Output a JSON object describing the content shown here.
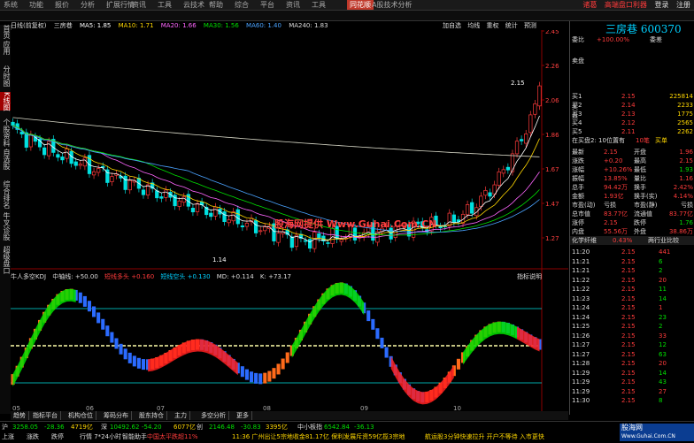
{
  "menu": [
    "系统",
    "功能",
    "报价",
    "分析",
    "扩展行情",
    "资讯",
    "工具",
    "云技术",
    "帮助",
    "综合",
    "平台",
    "资讯",
    "工具"
  ],
  "brand": "同花顺",
  "app_title": "A股技术分析",
  "right_links": [
    "诸葛",
    "高端盘口利器",
    "登录",
    "注册"
  ],
  "left_tabs": [
    "首页",
    "应用",
    "分时图",
    "K线图",
    "个股资料",
    "自选股",
    "综合排名",
    "牛叉诊股",
    "超级盘口"
  ],
  "chart_header": {
    "period": "日线(前复权)",
    "stock": "三房巷",
    "ma5": "MA5: 1.85",
    "ma10": "MA10: 1.71",
    "ma20": "MA20: 1.66",
    "ma30": "MA30: 1.56",
    "ma60": "MA60: 1.40",
    "ma240": "MA240: 1.83"
  },
  "tools": [
    "加自选",
    "均线",
    "重权",
    "统计",
    "预测"
  ],
  "price_axis": [
    "2.45",
    "2.26",
    "2.06",
    "1.86",
    "1.67",
    "1.47",
    "1.27"
  ],
  "price_labels": {
    "high": "2.15",
    "low": "1.14"
  },
  "watermark": "股海网提供 Www.Guhai.Com.CN",
  "lower_header": {
    "name": "牛人多空KDJ",
    "mid": "中轴线: +50.00",
    "s1": "短线多头 +0.160",
    "s2": "短线空头 +0.130",
    "md": "MD: +0.114",
    "k": "K: +73.17",
    "help": "指标说明"
  },
  "month_axis": [
    "05",
    "06",
    "07",
    "08",
    "09",
    "10"
  ],
  "bottom_tabs": [
    "趋势",
    "指标平台",
    "机构仓位",
    "筹码分布",
    "股东持仓",
    "主力",
    "多空分析",
    "更多"
  ],
  "quote": {
    "name": "三房巷 600370",
    "weibi": "委比",
    "weibi_val": "+100.00%",
    "wei_ratio": "委差",
    "sell_label": "卖盘",
    "buy_label": "买盘",
    "buy_rows": [
      [
        "买1",
        "2.15",
        "225814"
      ],
      [
        "买2",
        "2.14",
        "2233"
      ],
      [
        "买3",
        "2.13",
        "1775"
      ],
      [
        "买4",
        "2.12",
        "2565"
      ],
      [
        "买5",
        "2.11",
        "2262"
      ]
    ],
    "bid_info": "在买盘2: 10位置有",
    "bid_info2": "10笔",
    "bid_info3": "买单",
    "stats": [
      [
        "最新",
        "2.15",
        "开盘",
        "1.96"
      ],
      [
        "涨跌",
        "+0.20",
        "最高",
        "2.15"
      ],
      [
        "涨幅",
        "+10.26%",
        "最低",
        "1.93"
      ],
      [
        "振幅",
        "13.85%",
        "量比",
        "1.16"
      ],
      [
        "总手",
        "94.42万",
        "换手",
        "2.42%"
      ],
      [
        "金额",
        "1.93亿",
        "换手(实)",
        "4.14%"
      ],
      [
        "市盈(动)",
        "亏损",
        "市盈(静)",
        "亏损"
      ],
      [
        "总市值",
        "83.77亿",
        "流通值",
        "83.77亿"
      ],
      [
        "涨停",
        "2.15",
        "跌停",
        "1.76"
      ],
      [
        "内盘",
        "55.56万",
        "外盘",
        "38.86万"
      ]
    ],
    "industry": "化学纤维",
    "industry_pct": "0.43%",
    "industry_tab": "两行业比较",
    "ticks": [
      [
        "11:20",
        "2.15",
        "441"
      ],
      [
        "11:21",
        "2.15",
        "6"
      ],
      [
        "11:21",
        "2.15",
        "2"
      ],
      [
        "11:22",
        "2.15",
        "20"
      ],
      [
        "11:22",
        "2.15",
        "11"
      ],
      [
        "11:23",
        "2.15",
        "14"
      ],
      [
        "11:24",
        "2.15",
        "1"
      ],
      [
        "11:24",
        "2.15",
        "23"
      ],
      [
        "11:25",
        "2.15",
        "2"
      ],
      [
        "11:26",
        "2.15",
        "33"
      ],
      [
        "11:27",
        "2.15",
        "12"
      ],
      [
        "11:27",
        "2.15",
        "63"
      ],
      [
        "11:28",
        "2.15",
        "20"
      ],
      [
        "11:29",
        "2.15",
        "14"
      ],
      [
        "11:29",
        "2.15",
        "43"
      ],
      [
        "11:29",
        "2.15",
        "27"
      ],
      [
        "11:30",
        "2.15",
        "8"
      ]
    ]
  },
  "status": {
    "row1": [
      "沪",
      "3258.05",
      "-28.36",
      "4719亿",
      "深",
      "10492.62",
      "-54.20",
      "6077亿",
      "创",
      "2146.48",
      "-30.83",
      "3395亿",
      "中小板指",
      "6542.84",
      "-36.13"
    ],
    "row2": [
      "上涨",
      "涨跌",
      "跌停",
      "行情 7*24小时",
      "智能助手",
      "中国太平跌超11%",
      "11:36 广州出让5宗地收金81.17亿 保利发展斥资59亿揽3宗地",
      "航运股3分钟快速拉升 开户不等待 入市更快"
    ],
    "logo": "股海网",
    "logo_sub": "Www.Guhai.Com.CN"
  },
  "colors": {
    "up": "#ff3b3b",
    "down": "#00e0e0",
    "bg": "#000000",
    "accent": "#00d0ff"
  }
}
